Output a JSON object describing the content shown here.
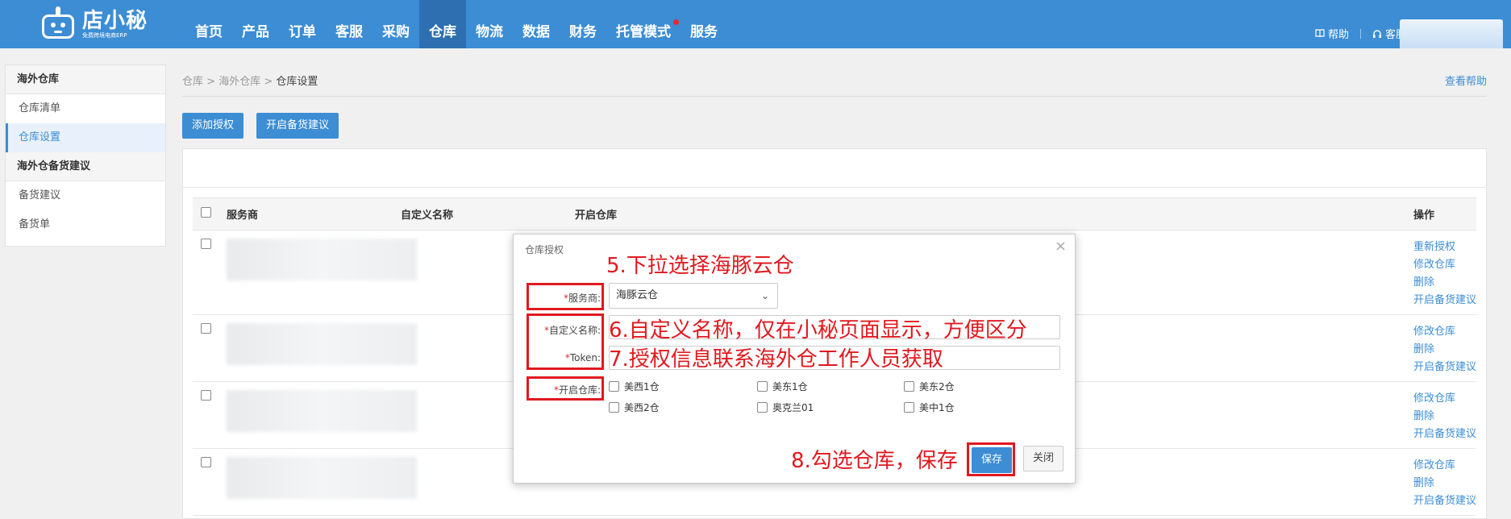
{
  "header": {
    "logo_name": "店小秘",
    "logo_sub": "免费跨境电商ERP",
    "nav": [
      {
        "label": "首页"
      },
      {
        "label": "产品"
      },
      {
        "label": "订单"
      },
      {
        "label": "客服"
      },
      {
        "label": "采购"
      },
      {
        "label": "仓库",
        "active": true
      },
      {
        "label": "物流"
      },
      {
        "label": "数据"
      },
      {
        "label": "财务"
      },
      {
        "label": "托管模式",
        "dot": true
      },
      {
        "label": "服务"
      }
    ],
    "help": "帮助",
    "service": "客服"
  },
  "sidebar": {
    "group1": "海外仓库",
    "items1": [
      "仓库清单",
      "仓库设置"
    ],
    "group2": "海外仓备货建议",
    "items2": [
      "备货建议",
      "备货单"
    ]
  },
  "breadcrumb": {
    "l1": "仓库",
    "l2": "海外仓库",
    "current": "仓库设置"
  },
  "help_link": "查看帮助",
  "toolbar": {
    "add_auth": "添加授权",
    "open_stock": "开启备货建议"
  },
  "table": {
    "headers": {
      "provider": "服务商",
      "custom_name": "自定义名称",
      "open_warehouse": "开启仓库",
      "ops": "操作"
    },
    "rows": [
      {
        "ops": [
          "重新授权",
          "修改仓库",
          "删除",
          "开启备货建议"
        ]
      },
      {
        "ops": [
          "修改仓库",
          "删除",
          "开启备货建议"
        ]
      },
      {
        "ops": [
          "修改仓库",
          "删除",
          "开启备货建议"
        ]
      },
      {
        "ops": [
          "修改仓库",
          "删除",
          "开启备货建议"
        ]
      }
    ]
  },
  "modal": {
    "title": "仓库授权",
    "provider_label": "服务商:",
    "provider_value": "海豚云仓",
    "custom_label": "自定义名称:",
    "token_label": "Token:",
    "warehouses_label": "开启仓库:",
    "warehouses": [
      "美西1仓",
      "美东1仓",
      "美东2仓",
      "美西2仓",
      "奥克兰01",
      "美中1仓"
    ],
    "save": "保存",
    "close": "关闭"
  },
  "annotations": {
    "a5": "5.下拉选择海豚云仓",
    "a6": "6.自定义名称，仅在小秘页面显示，方便区分",
    "a7": "7.授权信息联系海外仓工作人员获取",
    "a8": "8.勾选仓库，保存"
  },
  "colors": {
    "brand": "#3c8dd4",
    "annotation": "#e0191f"
  }
}
